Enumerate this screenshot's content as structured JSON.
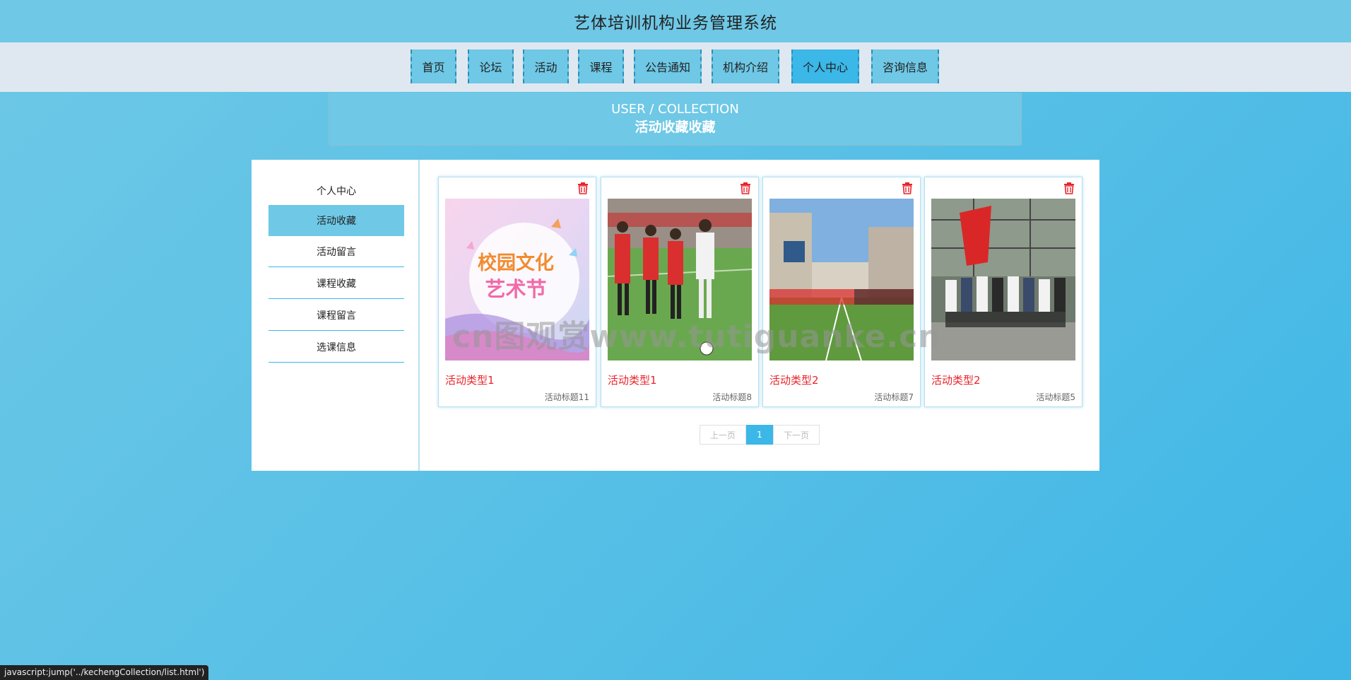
{
  "header": {
    "title": "艺体培训机构业务管理系统"
  },
  "nav": {
    "items": [
      {
        "label": "首页"
      },
      {
        "label": "论坛"
      },
      {
        "label": "活动"
      },
      {
        "label": "课程"
      },
      {
        "label": "公告通知"
      },
      {
        "label": "机构介绍"
      },
      {
        "label": "个人中心"
      },
      {
        "label": "咨询信息"
      }
    ],
    "active": "个人中心"
  },
  "banner": {
    "en": "USER / COLLECTION",
    "zh": "活动收藏收藏"
  },
  "sidebar": {
    "items": [
      {
        "label": "个人中心"
      },
      {
        "label": "活动收藏"
      },
      {
        "label": "活动留言"
      },
      {
        "label": "课程收藏"
      },
      {
        "label": "课程留言"
      },
      {
        "label": "选课信息"
      }
    ],
    "active": "活动收藏"
  },
  "cards": [
    {
      "type": "活动类型1",
      "title": "活动标题11",
      "image_text_1": "校园文化",
      "image_text_2": "艺术节"
    },
    {
      "type": "活动类型1",
      "title": "活动标题8"
    },
    {
      "type": "活动类型2",
      "title": "活动标题7"
    },
    {
      "type": "活动类型2",
      "title": "活动标题5"
    }
  ],
  "pagination": {
    "prev": "上一页",
    "current": "1",
    "next": "下一页"
  },
  "watermark": "cn图观赏www.tutiguanke.cn",
  "status_bar": "javascript:jump('../kechengCollection/list.html')",
  "colors": {
    "accent": "#3bb7e8",
    "header": "#6ec8e6",
    "nav_bg": "#dfe8f0",
    "card_type": "#e8242b"
  }
}
